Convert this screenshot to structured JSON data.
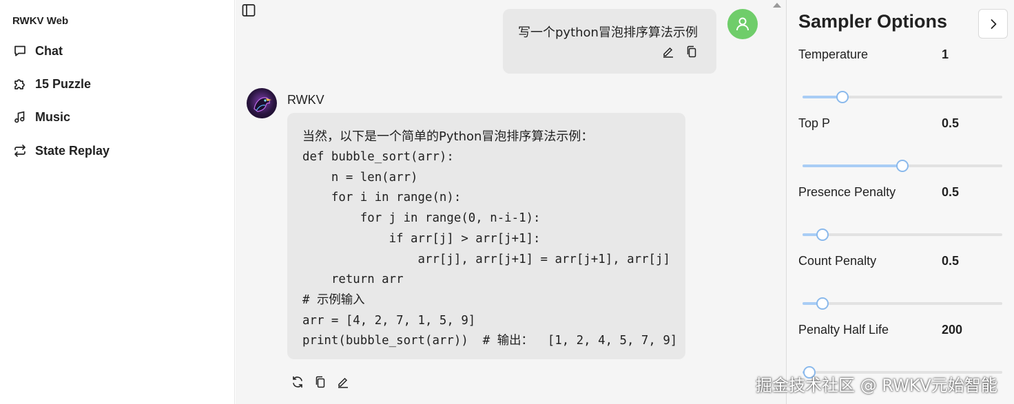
{
  "sidebar": {
    "app_title": "RWKV Web",
    "items": [
      {
        "label": "Chat",
        "icon": "chat-bubble-icon"
      },
      {
        "label": "15 Puzzle",
        "icon": "puzzle-icon"
      },
      {
        "label": "Music",
        "icon": "music-note-icon"
      },
      {
        "label": "State Replay",
        "icon": "arrows-swap-icon"
      }
    ]
  },
  "chat": {
    "user_message": "写一个python冒泡排序算法示例",
    "bot_name": "RWKV",
    "bot_intro": "当然，以下是一个简单的Python冒泡排序算法示例：",
    "code_lines": [
      "def bubble_sort(arr):",
      "    n = len(arr)",
      "    for i in range(n):",
      "        for j in range(0, n-i-1):",
      "            if arr[j] > arr[j+1]:",
      "                arr[j], arr[j+1] = arr[j+1], arr[j]",
      "    return arr",
      "# 示例输入",
      "arr = [4, 2, 7, 1, 5, 9]",
      "print(bubble_sort(arr))  # 输出：  [1, 2, 4, 5, 7, 9]"
    ]
  },
  "panel": {
    "title": "Sampler Options",
    "options": [
      {
        "label": "Temperature",
        "value": "1",
        "fill": 0.2
      },
      {
        "label": "Top P",
        "value": "0.5",
        "fill": 0.5
      },
      {
        "label": "Presence Penalty",
        "value": "0.5",
        "fill": 0.1
      },
      {
        "label": "Count Penalty",
        "value": "0.5",
        "fill": 0.1
      },
      {
        "label": "Penalty Half Life",
        "value": "200",
        "fill": 0.0
      }
    ]
  },
  "watermark": "掘金技术社区 @ RWKV元始智能",
  "colors": {
    "user_avatar": "#6fcd6a",
    "slider_fill": "#a9cdf5",
    "slider_thumb_border": "#8ab9ec",
    "bubble_bg": "#e8e8e8"
  }
}
